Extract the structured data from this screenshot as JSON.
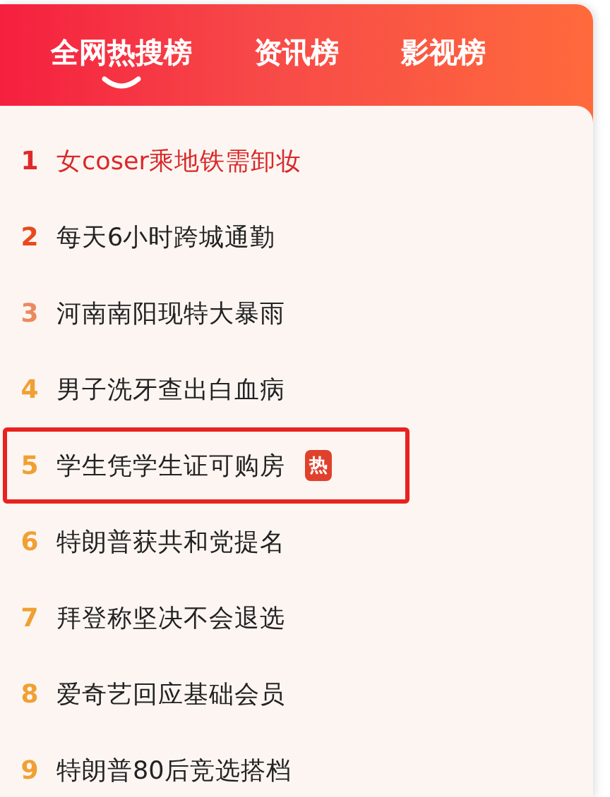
{
  "tabs": [
    {
      "label": "全网热搜榜",
      "selected": true
    },
    {
      "label": "资讯榜",
      "selected": false
    },
    {
      "label": "影视榜",
      "selected": false
    }
  ],
  "items": [
    {
      "rank": "1",
      "title": "女coser乘地铁需卸妆",
      "color": "#e0282b",
      "selected": true,
      "outlined": false
    },
    {
      "rank": "2",
      "title": "每天6小时跨城通勤",
      "color": "#e8491d",
      "selected": false,
      "outlined": false
    },
    {
      "rank": "3",
      "title": "河南南阳现特大暴雨",
      "color": "#ea8a5e",
      "selected": false,
      "outlined": false
    },
    {
      "rank": "4",
      "title": "男子洗牙查出白血病",
      "color": "#f0a033",
      "selected": false,
      "outlined": false
    },
    {
      "rank": "5",
      "title": "学生凭学生证可购房",
      "color": "#f0a033",
      "selected": false,
      "outlined": true,
      "badge": "热"
    },
    {
      "rank": "6",
      "title": "特朗普获共和党提名",
      "color": "#f0a033",
      "selected": false,
      "outlined": false
    },
    {
      "rank": "7",
      "title": "拜登称坚决不会退选",
      "color": "#f0a033",
      "selected": false,
      "outlined": false
    },
    {
      "rank": "8",
      "title": "爱奇艺回应基础会员",
      "color": "#f0a033",
      "selected": false,
      "outlined": false
    },
    {
      "rank": "9",
      "title": "特朗普80后竞选搭档",
      "color": "#f0a033",
      "selected": false,
      "outlined": false
    }
  ]
}
